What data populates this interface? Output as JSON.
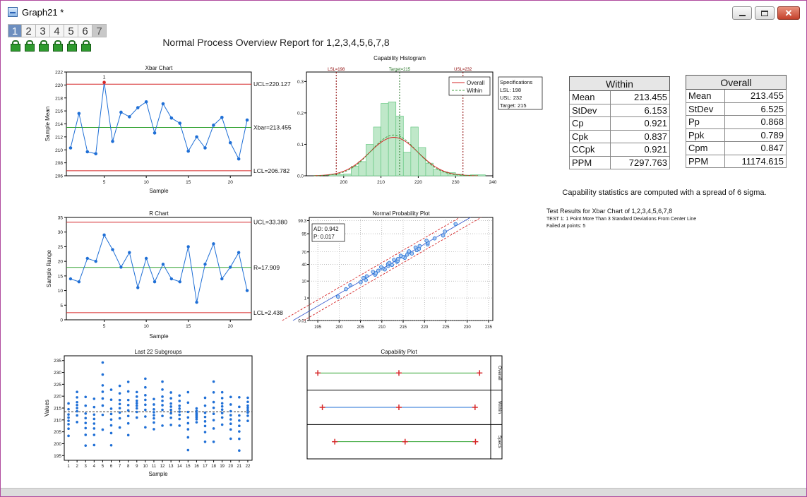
{
  "window": {
    "title": "Graph21 *",
    "minimize": "",
    "maximize": "",
    "close": "✕"
  },
  "layer_tabs": [
    "1",
    "2",
    "3",
    "4",
    "5",
    "6",
    "7"
  ],
  "report_title": "Normal Process Overview Report for 1,2,3,4,5,6,7,8",
  "xbar": {
    "title": "Xbar Chart",
    "xlabel": "Sample",
    "ylabel": "Sample Mean",
    "y_ticks": [
      206,
      208,
      210,
      212,
      214,
      216,
      218,
      220,
      222
    ],
    "ylim": [
      206,
      222
    ],
    "x_ticks": [
      5,
      10,
      15,
      20
    ],
    "xlim": [
      0.5,
      22.5
    ],
    "values": [
      210.3,
      215.6,
      209.7,
      209.4,
      220.4,
      211.3,
      215.8,
      215.1,
      216.5,
      217.4,
      212.6,
      217.1,
      214.9,
      214.1,
      209.8,
      212.0,
      210.3,
      213.8,
      215.0,
      211.1,
      208.6,
      214.6
    ],
    "ucl": 220.127,
    "center": 213.455,
    "lcl": 206.782,
    "ucl_label": "UCL=220.127",
    "center_label": "Xbar=213.455",
    "lcl_label": "LCL=206.782",
    "flag_label": "1"
  },
  "rchart": {
    "title": "R Chart",
    "xlabel": "Sample",
    "ylabel": "Sample Range",
    "y_ticks": [
      0,
      5,
      10,
      15,
      20,
      25,
      30,
      35
    ],
    "ylim": [
      0,
      35
    ],
    "x_ticks": [
      5,
      10,
      15,
      20
    ],
    "xlim": [
      0.5,
      22.5
    ],
    "values": [
      14,
      13,
      21,
      20,
      29,
      24,
      18,
      23,
      11,
      21,
      13,
      19,
      14,
      13,
      25,
      6,
      19,
      26,
      14,
      18,
      23,
      10
    ],
    "ucl": 33.38,
    "center": 17.909,
    "lcl": 2.438,
    "ucl_label": "UCL=33.380",
    "center_label": "R=17.909",
    "lcl_label": "LCL=2.438"
  },
  "subgroups": {
    "title": "Last 22 Subgroups",
    "xlabel": "Sample",
    "ylabel": "Values",
    "y_ticks": [
      195,
      200,
      205,
      210,
      215,
      220,
      225,
      230,
      235
    ],
    "ylim": [
      193,
      237
    ],
    "x_ticks": [
      1,
      2,
      3,
      4,
      5,
      6,
      7,
      8,
      9,
      10,
      11,
      12,
      13,
      14,
      15,
      16,
      17,
      18,
      19,
      20,
      21,
      22
    ],
    "center": 213.455
  },
  "histogram": {
    "title": "Capability Histogram",
    "y_ticks": [
      0.0,
      0.1,
      0.2,
      0.3
    ],
    "ylim": [
      0,
      0.33
    ],
    "x_ticks": [
      200,
      210,
      220,
      230,
      240
    ],
    "xlim": [
      190,
      240
    ],
    "bin_edges": [
      196,
      198,
      200,
      202,
      204,
      206,
      208,
      210,
      212,
      214,
      216,
      218,
      220,
      222,
      224,
      226,
      228,
      230,
      232,
      234,
      236,
      238
    ],
    "bin_values": [
      0.004,
      0.004,
      0.006,
      0.03,
      0.045,
      0.1,
      0.155,
      0.23,
      0.235,
      0.19,
      0.075,
      0.155,
      0.09,
      0.04,
      0.02,
      0.012,
      0.01,
      0.005,
      0.002,
      0.003,
      0.003
    ],
    "lsl": 198,
    "usl": 232,
    "target": 215,
    "lsl_label": "LSL=198",
    "usl_label": "USL=232",
    "target_label": "Target=215",
    "legend": [
      "Overall",
      "Within"
    ],
    "spec_box": {
      "title": "Specifications",
      "lsl": "LSL: 198",
      "usl": "USL: 232",
      "target": "Target: 215"
    }
  },
  "probability": {
    "title": "Normal Probability Plot",
    "y_ticks": [
      "0.01",
      "1",
      "10",
      "40",
      "70",
      "95",
      "99.3"
    ],
    "y_values": [
      0.01,
      1,
      10,
      40,
      70,
      95,
      99.3
    ],
    "x_ticks": [
      195,
      200,
      205,
      210,
      215,
      220,
      225,
      230,
      235
    ],
    "xlim": [
      193,
      236
    ],
    "ad_label": "AD: 0.942",
    "p_label": "P: 0.017"
  },
  "capability_plot": {
    "title": "Capability Plot",
    "rows": [
      {
        "name": "Overall",
        "low": 193.9,
        "mid": 213.5,
        "high": 233.0
      },
      {
        "name": "Within",
        "low": 195.0,
        "mid": 213.5,
        "high": 231.9
      },
      {
        "name": "Specs",
        "low": 198,
        "mid": 215,
        "high": 232
      }
    ],
    "xlim": [
      192,
      235
    ]
  },
  "within": {
    "header": "Within",
    "rows": [
      [
        "Mean",
        "213.455"
      ],
      [
        "StDev",
        "6.153"
      ],
      [
        "Cp",
        "0.921"
      ],
      [
        "Cpk",
        "0.837"
      ],
      [
        "CCpk",
        "0.921"
      ],
      [
        "PPM",
        "7297.763"
      ]
    ]
  },
  "overall": {
    "header": "Overall",
    "rows": [
      [
        "Mean",
        "213.455"
      ],
      [
        "StDev",
        "6.525"
      ],
      [
        "Pp",
        "0.868"
      ],
      [
        "Ppk",
        "0.789"
      ],
      [
        "Cpm",
        "0.847"
      ],
      [
        "PPM",
        "11174.615"
      ]
    ]
  },
  "stats_note": "Capability statistics are computed with a spread of 6 sigma.",
  "test_results": {
    "title": "Test Results for Xbar Chart of 1,2,3,4,5,6,7,8",
    "test1": "TEST 1: 1 Point More Than 3 Standard Deviations From Center Line",
    "failed": "Failed at points: 5"
  },
  "colors": {
    "line": "#1f6fd6",
    "ctrl": "#d62728",
    "center": "#2ca02c",
    "bar": "#bfe8c9",
    "bar_edge": "#67c783",
    "spec": "#8b0000"
  }
}
